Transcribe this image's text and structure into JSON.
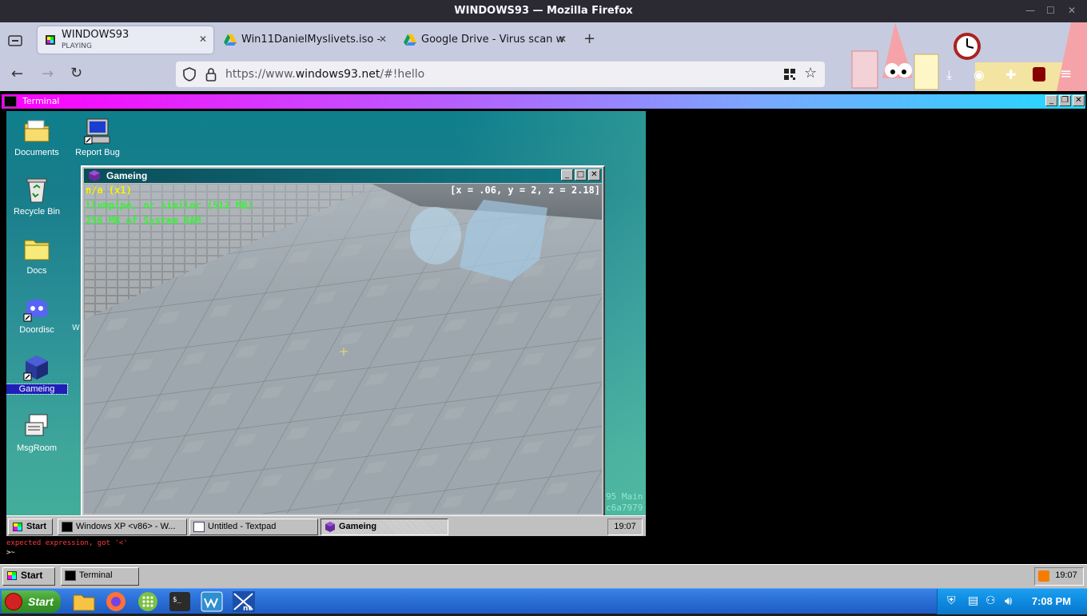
{
  "browser": {
    "window_title": "WINDOWS93 — Mozilla Firefox",
    "tabs": [
      {
        "title": "WINDOWS93",
        "subtitle": "PLAYING",
        "active": true
      },
      {
        "title": "Win11DanielMyslivets.iso -",
        "active": false
      },
      {
        "title": "Google Drive - Virus scan w",
        "active": false
      }
    ],
    "url": {
      "prefix": "https://www.",
      "domain": "windows93.net",
      "path": "/#!hello"
    }
  },
  "terminal_window": {
    "title": "Terminal",
    "output": [
      {
        "text": "expected expression, got '<'",
        "color": "#ff3b3b"
      },
      {
        "text": ">~",
        "color": "#ffffff"
      }
    ]
  },
  "desktop_icons": [
    {
      "label": "Documents",
      "icon": "folder-documents-icon"
    },
    {
      "label": "Report Bug",
      "icon": "computer-icon"
    },
    {
      "label": "Recycle Bin",
      "icon": "recycle-bin-icon"
    },
    {
      "label": "Docs",
      "icon": "folder-icon"
    },
    {
      "label": "Doordisc",
      "icon": "discord-icon"
    },
    {
      "label": "Gameing",
      "icon": "cube-icon",
      "selected": true
    },
    {
      "label": "MsgRoom",
      "icon": "chat-icon"
    }
  ],
  "game_window": {
    "title": "Gameing",
    "hud": {
      "line1": "n/a (x1)",
      "line2": "llvmpipe, or similar (512 MB)",
      "line3": "256 MB of System RAM",
      "coords": "[x = .06, y = 2, z = 2.18]"
    },
    "bg_text": {
      "t1": "95 Main",
      "t2": "c6a7979",
      "t3": "W"
    }
  },
  "w93_taskbar": {
    "start_label": "Start",
    "tasks": [
      {
        "label": "Windows XP <v86> - W...",
        "pressed": false
      },
      {
        "label": "Untitled - Textpad",
        "pressed": false
      },
      {
        "label": "Gameing",
        "pressed": true
      }
    ],
    "clock": "19:07"
  },
  "outer_taskbar": {
    "start_label": "Start",
    "tasks": [
      {
        "label": "Terminal"
      }
    ],
    "clock": "19:07"
  },
  "os_taskbar": {
    "start_label": "Start",
    "apps": [
      "folder-icon",
      "firefox-icon",
      "apps-grid-icon",
      "terminal-icon",
      "wireshark-icon",
      "windows-nt-icon"
    ],
    "clock": "7:08 PM"
  },
  "colors": {
    "firefox_chrome": "#c7cbe0",
    "terminal_title_gradient": [
      "#ff00ff",
      "#23d9ff"
    ],
    "hud_yellow": "#f5f500",
    "hud_green": "#3cf03c",
    "xp_blue": "#2a6fd6",
    "xp_green": "#3a9b2a"
  }
}
